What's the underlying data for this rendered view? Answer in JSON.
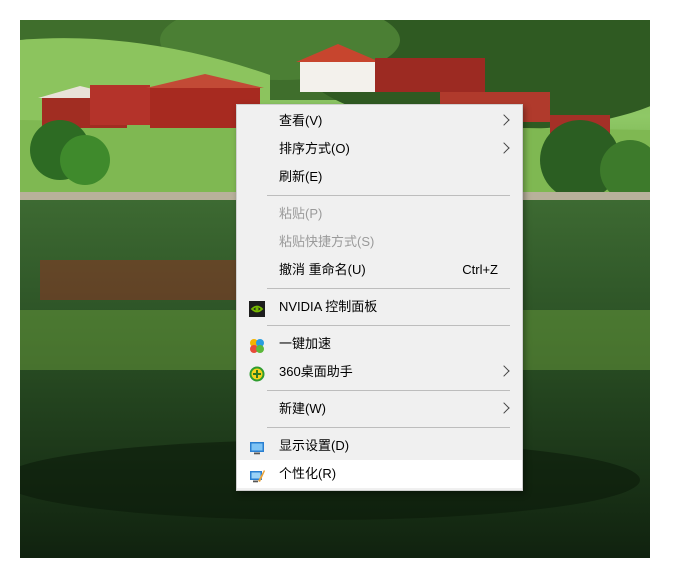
{
  "menu": {
    "view": {
      "label": "查看(V)"
    },
    "sort": {
      "label": "排序方式(O)"
    },
    "refresh": {
      "label": "刷新(E)"
    },
    "paste": {
      "label": "粘贴(P)"
    },
    "paste_shortcut": {
      "label": "粘贴快捷方式(S)"
    },
    "undo_rename": {
      "label": "撤消 重命名(U)",
      "shortcut": "Ctrl+Z"
    },
    "nvidia": {
      "label": "NVIDIA 控制面板",
      "icon": "nvidia-icon"
    },
    "speedup": {
      "label": "一键加速",
      "icon": "speedup-icon"
    },
    "desktop_helper": {
      "label": "360桌面助手",
      "icon": "360-helper-icon"
    },
    "new": {
      "label": "新建(W)"
    },
    "display_settings": {
      "label": "显示设置(D)",
      "icon": "monitor-icon"
    },
    "personalize": {
      "label": "个性化(R)",
      "icon": "personalize-icon"
    }
  },
  "colors": {
    "menu_bg": "#f0f0f0",
    "hover_bg": "#ffffff",
    "disabled_text": "#9a9a9a"
  }
}
